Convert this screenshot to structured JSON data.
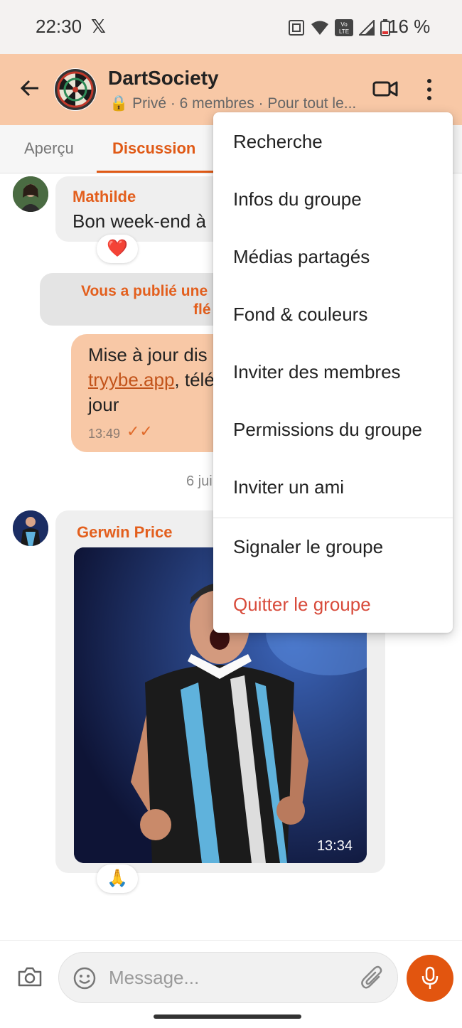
{
  "status_bar": {
    "time": "22:30",
    "x_label": "𝕏",
    "battery": "16 %"
  },
  "header": {
    "group_name": "DartSociety",
    "subtitle": "Privé · 6 membres · Pour tout le...",
    "lock": "🔒"
  },
  "tabs": [
    {
      "label": "Aperçu"
    },
    {
      "label": "Discussion"
    }
  ],
  "messages": {
    "m1": {
      "sender": "Mathilde",
      "text": "Bon week-end à",
      "reaction": "❤️"
    },
    "system": {
      "line1": "Vous a publié une",
      "line2": "flé"
    },
    "outgoing": {
      "line1": "Mise à jour dis",
      "link": "tryybe.app",
      "line2_rest": ", télé",
      "line3": "jour",
      "time": "13:49",
      "ticks": "✓✓"
    },
    "date_chip": "6 jui",
    "m2": {
      "sender": "Gerwin Price",
      "photo_time": "13:34",
      "reaction": "🙏"
    }
  },
  "input": {
    "placeholder": "Message..."
  },
  "menu": {
    "items": [
      {
        "label": "Recherche"
      },
      {
        "label": "Infos du groupe"
      },
      {
        "label": "Médias partagés"
      },
      {
        "label": "Fond & couleurs"
      },
      {
        "label": "Inviter des membres"
      },
      {
        "label": "Permissions du groupe"
      },
      {
        "label": "Inviter un ami"
      }
    ],
    "report": "Signaler le groupe",
    "quit": "Quitter le groupe"
  },
  "colors": {
    "accent": "#e05a16",
    "header_bg": "#f8c8a6",
    "danger": "#d84b3b"
  }
}
